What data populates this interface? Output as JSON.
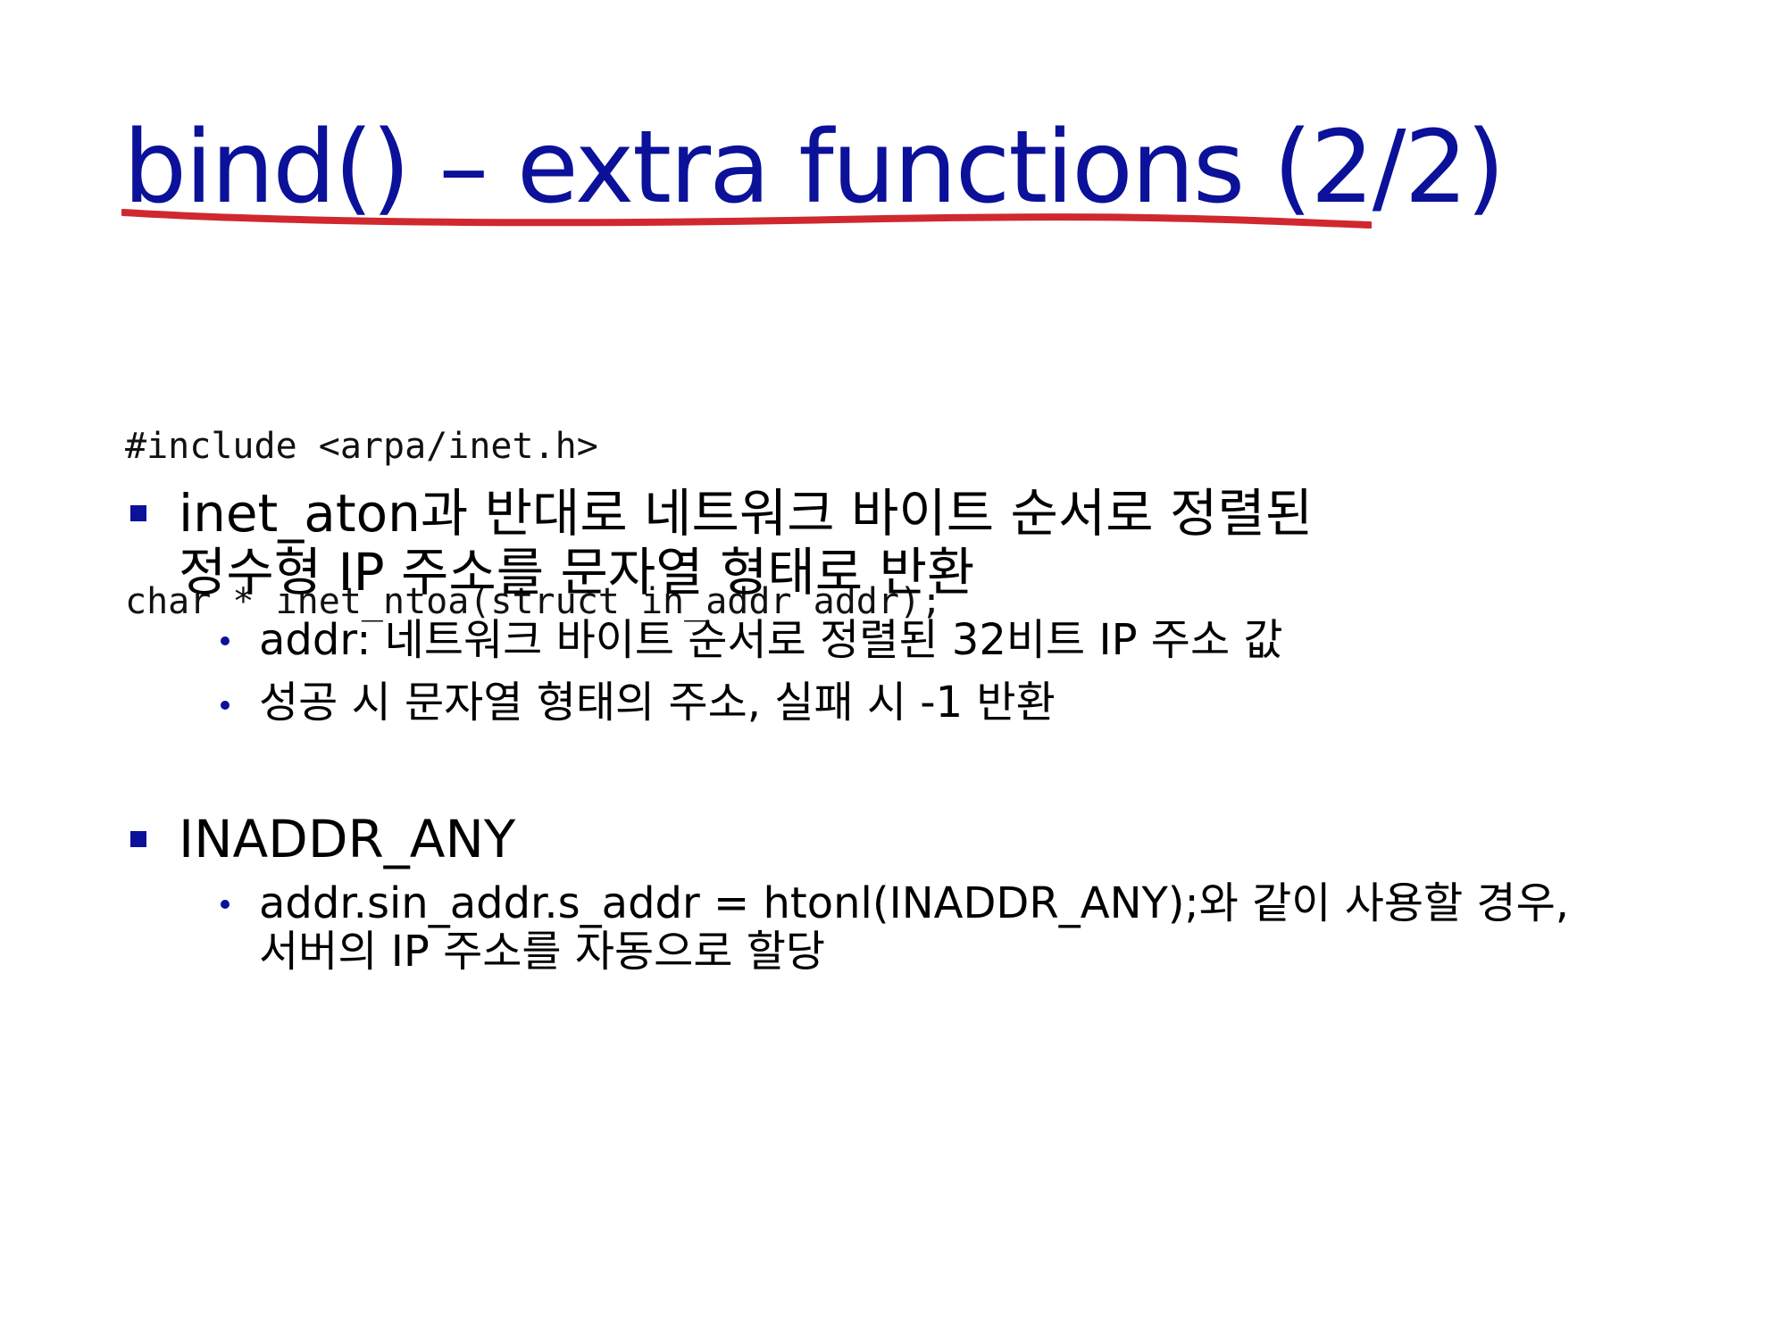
{
  "slide": {
    "title": "bind() – extra functions (2/2)",
    "accent_color": "#0b1199",
    "underline_color": "#d0282e",
    "code": [
      "#include <arpa/inet.h>",
      "char * inet_ntoa(struct in_addr addr);"
    ],
    "bullets": [
      {
        "lines": [
          "inet_aton과 반대로 네트워크 바이트 순서로 정렬된",
          "정수형 IP 주소를 문자열 형태로 반환"
        ],
        "sub": [
          {
            "lines": [
              "addr: 네트워크 바이트 순서로 정렬된 32비트 IP 주소 값"
            ]
          },
          {
            "lines": [
              "성공 시 문자열 형태의 주소, 실패 시 -1 반환"
            ]
          }
        ]
      },
      {
        "lines": [
          "INADDR_ANY"
        ],
        "sub": [
          {
            "lines": [
              "addr.sin_addr.s_addr = htonl(INADDR_ANY);와 같이 사용할 경우,",
              "서버의 IP 주소를 자동으로 할당"
            ]
          }
        ]
      }
    ]
  }
}
